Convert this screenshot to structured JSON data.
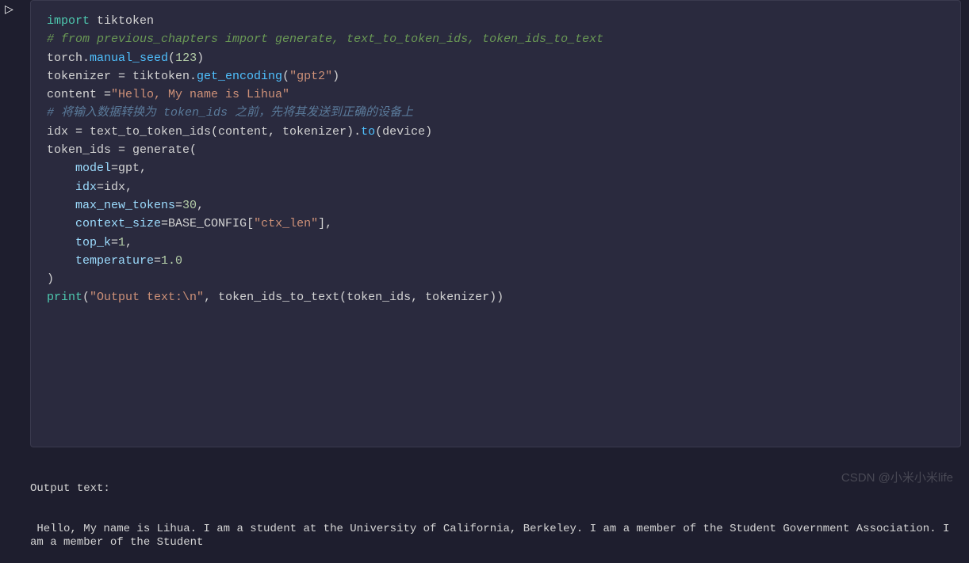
{
  "play_icon": "▷",
  "code": {
    "line1_import": "import",
    "line1_module": " tiktoken",
    "line2_comment": "# from previous_chapters import generate, text_to_token_ids, token_ids_to_text",
    "line3_empty": "",
    "line4_torch": "torch.",
    "line4_method": "manual_seed",
    "line4_paren_open": "(",
    "line4_num": "123",
    "line4_paren_close": ")",
    "line5_empty": "",
    "line6_var": "tokenizer = tiktoken.",
    "line6_method": "get_encoding",
    "line6_paren_open": "(",
    "line6_str": "\"gpt2\"",
    "line6_paren_close": ")",
    "line7_empty": "",
    "line8_empty": "",
    "line9_var": "content =",
    "line9_str": "\"Hello, My name is Lihua\"",
    "line10_comment": "# 将输入数据转换为 token_ids 之前，先将其发送到正确的设备上",
    "line11_var": "idx = text_to_token_ids(content, tokenizer).",
    "line11_method": "to",
    "line11_rest": "(device)",
    "line12_empty": "",
    "line13": "token_ids = generate(",
    "line14_indent": "    model",
    "line14_eq": "=",
    "line14_val": "gpt,",
    "line15_indent": "    idx",
    "line15_eq": "=",
    "line15_val": "idx,",
    "line16_indent": "    max_new_tokens",
    "line16_eq": "=",
    "line16_num": "30",
    "line16_comma": ",",
    "line17_indent": "    context_size",
    "line17_eq": "=",
    "line17_val": "BASE_CONFIG[",
    "line17_str": "\"ctx_len\"",
    "line17_close": "],",
    "line18_indent": "    top_k",
    "line18_eq": "=",
    "line18_num": "1",
    "line18_comma": ",",
    "line19_indent": "    temperature",
    "line19_eq": "=",
    "line19_num": "1.0",
    "line20": ")",
    "line21_empty": "",
    "line22_print": "print",
    "line22_paren": "(",
    "line22_str": "\"Output text:\\n\"",
    "line22_rest": ", token_ids_to_text(token_ids, tokenizer))"
  },
  "output": {
    "header": "Output text:",
    "body": " Hello, My name is Lihua. I am a student at the University of California, Berkeley. I am a member of the Student Government Association. I am a member of the Student"
  },
  "watermark": "CSDN @小米小米life"
}
